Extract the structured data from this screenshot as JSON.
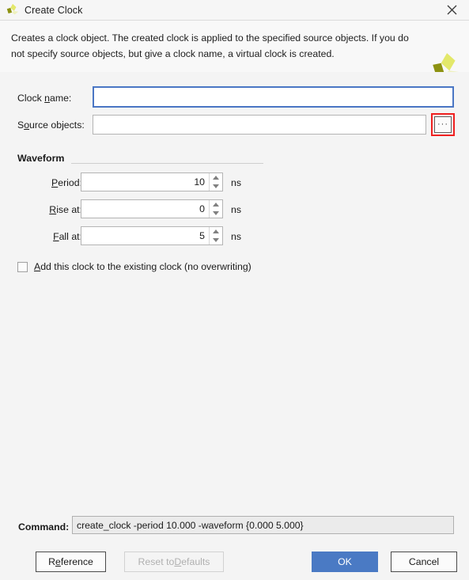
{
  "window": {
    "title": "Create Clock",
    "icon": "vivado-logo-icon",
    "close_label": "✕"
  },
  "description": {
    "text": "Creates a clock object. The created clock is applied to the specified source objects. If you do not specify source objects, but give a clock name, a virtual clock is created.",
    "logo": "vivado-logo-icon"
  },
  "fields": {
    "clock_name": {
      "label_prefix": "Clock ",
      "label_mnemonic": "n",
      "label_suffix": "ame:",
      "value": "",
      "placeholder": ""
    },
    "source_objects": {
      "label_prefix": "S",
      "label_mnemonic": "o",
      "label_suffix": "urce objects:",
      "value": "",
      "placeholder": "",
      "browse_label": "···"
    }
  },
  "waveform": {
    "title": "Waveform",
    "rows": [
      {
        "label_prefix": "",
        "label_mnemonic": "P",
        "label_suffix": "eriod:",
        "value": "10",
        "unit": "ns",
        "name": "period"
      },
      {
        "label_prefix": "",
        "label_mnemonic": "R",
        "label_suffix": "ise at:",
        "value": "0",
        "unit": "ns",
        "name": "rise-at"
      },
      {
        "label_prefix": "",
        "label_mnemonic": "F",
        "label_suffix": "all at:",
        "value": "5",
        "unit": "ns",
        "name": "fall-at"
      }
    ]
  },
  "checkbox": {
    "checked": false,
    "label_prefix": "",
    "label_mnemonic": "A",
    "label_suffix": "dd this clock to the existing clock (no overwriting)"
  },
  "command": {
    "label": "Command:",
    "value": "create_clock -period 10.000 -waveform {0.000 5.000}"
  },
  "buttons": {
    "reference": {
      "prefix": "R",
      "mnemonic": "e",
      "suffix": "ference",
      "enabled": true
    },
    "reset": {
      "prefix": "Reset to ",
      "mnemonic": "D",
      "suffix": "efaults",
      "enabled": false
    },
    "ok": {
      "label": "OK",
      "enabled": true
    },
    "cancel": {
      "label": "Cancel",
      "enabled": true
    }
  },
  "colors": {
    "accent_blue": "#4a7ac4",
    "focus_blue": "#4a76c4",
    "highlight_red": "#f02020",
    "window_bg": "#f4f4f4",
    "logo_olive": "#a8ab22",
    "logo_yellow": "#e3e86a",
    "logo_pale": "#eef1bd"
  }
}
